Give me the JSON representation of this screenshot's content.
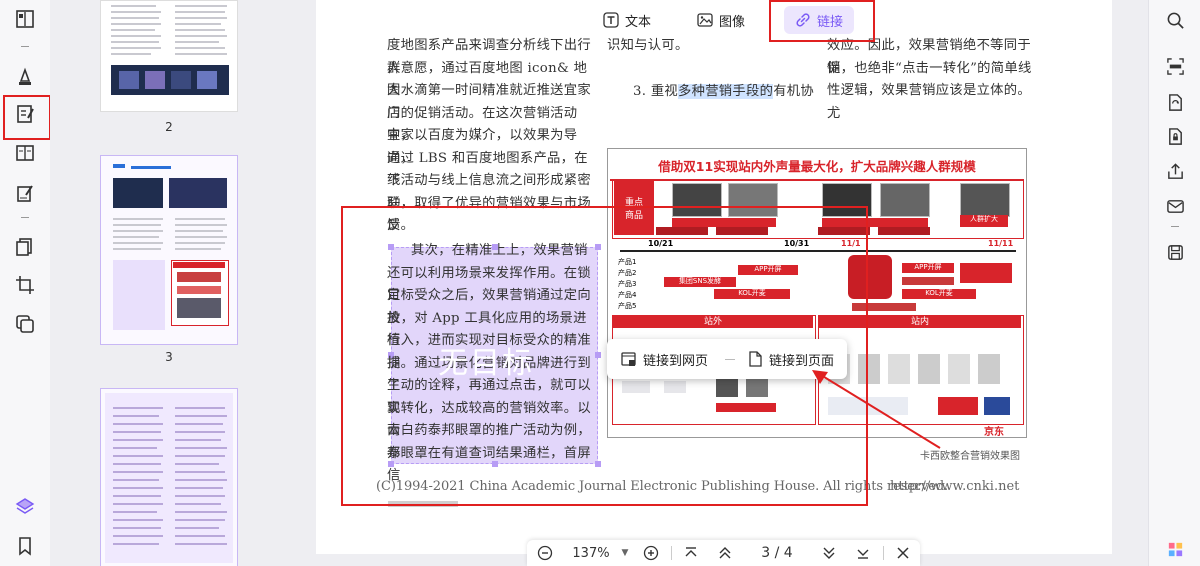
{
  "toolbar": {
    "text_label": "文本",
    "image_label": "图像",
    "link_label": "链接",
    "accent": "#7a5af5",
    "highlight_red": "#e02020"
  },
  "thumbnails": [
    {
      "label": "2"
    },
    {
      "label": "3"
    }
  ],
  "document": {
    "left_column": [
      "度地图系产品来调查分析线下出行人",
      "群意愿，通过百度地图 icon& 地图",
      "大水滴第一时间精准就近推送宜家门",
      "店的促销活动。在这次营销活动中，",
      "宜家以百度为媒介，以效果为导向，",
      "通过 LBS 和百度地图系产品，在线",
      "下活动与线上信息流之间形成紧密联",
      "动，取得了优异的营销效果与市场反",
      "馈。"
    ],
    "selected_text": [
      "其次，在精准上上，效果营销",
      "还可以利用场景来发挥作用。在锁定",
      "目标受众之后，效果营销通过定向投",
      "放，对 App 工具化应用的场景进行",
      "植入，进而实现对目标受众的精准捕",
      "捉。通过场景化营销对品牌进行到了",
      "生动的诠释，再通过点击，就可以实",
      "现转化，达成较高的营销效率。以云",
      "南白药泰邦眼罩的推广活动为例，泰",
      "邦眼罩在有道查词结果通栏，首屏信"
    ],
    "watermark": "无目标",
    "middle_top": "识知与认可。",
    "middle_heading_prefix": "3. 重视",
    "middle_heading_highlight": "多种营销手段的",
    "middle_heading_suffix": "有机协",
    "right_column": [
      "效应。因此，效果营销绝不等同于促",
      "销，也绝非“点击一转化”的简单线",
      "性逻辑，效果营销应该是立体的。尤"
    ],
    "figure_title": "借助双11实现站内外声量最大化，扩大品牌兴趣人群规模",
    "figure_caption": "卡西欧整合营销效果图",
    "figure_labels": {
      "key_products": "重点\n商品",
      "dates": [
        "10/21",
        "10/31",
        "11/1",
        "11/11"
      ],
      "products": [
        "产品1",
        "产品2",
        "产品3",
        "产品4",
        "产品5"
      ],
      "off_site": "站外",
      "on_site": "站内",
      "app_open": "APP开屏",
      "sns": "集团SNS发酵",
      "kol": "KOL开麦",
      "jd": "京东",
      "people_expand": "人群扩大"
    },
    "footer_copyright": "(C)1994-2021 China Academic Journal Electronic Publishing House. All rights reserved.",
    "footer_url": "http://www.cnki.net"
  },
  "link_popup": {
    "web_label": "链接到网页",
    "page_label": "链接到页面"
  },
  "nav": {
    "zoom": "137%",
    "current_page": "3",
    "total_pages": "4",
    "page_display": "3 / 4"
  }
}
